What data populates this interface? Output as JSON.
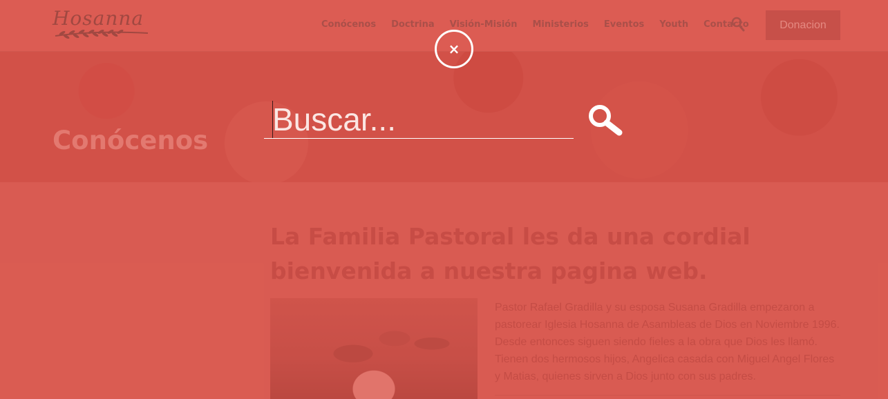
{
  "header": {
    "logo_text": "Hosanna",
    "nav": [
      "Conócenos",
      "Doctrina",
      "Visión-Misión",
      "Ministerios",
      "Eventos",
      "Youth",
      "Contacto"
    ],
    "donate_label": "Donacion",
    "search_icon": "search-icon"
  },
  "hero": {
    "title": "Conócenos"
  },
  "content": {
    "heading": "La Familia Pastoral les da una cordial bienvenida a nuestra pagina web.",
    "paragraph": "Pastor Rafael Gradilla y su esposa Susana Gradilla empezaron a pastorear Iglesia Hosanna de Asambleas de Dios en Noviembre 1996. Desde entonces siguen siendo fieles a la obra que Dios les llamó. Tienen dos hermosos hijos, Angelica casada con Miguel Angel Flores y Matias, quienes sirven a Dios junto con sus padres."
  },
  "search_overlay": {
    "placeholder": "Buscar...",
    "value": "",
    "close_symbol": "×",
    "submit_icon": "search-icon"
  },
  "colors": {
    "overlay": "#d55d53",
    "text_light": "#ffffff",
    "heading": "#b8463f"
  }
}
